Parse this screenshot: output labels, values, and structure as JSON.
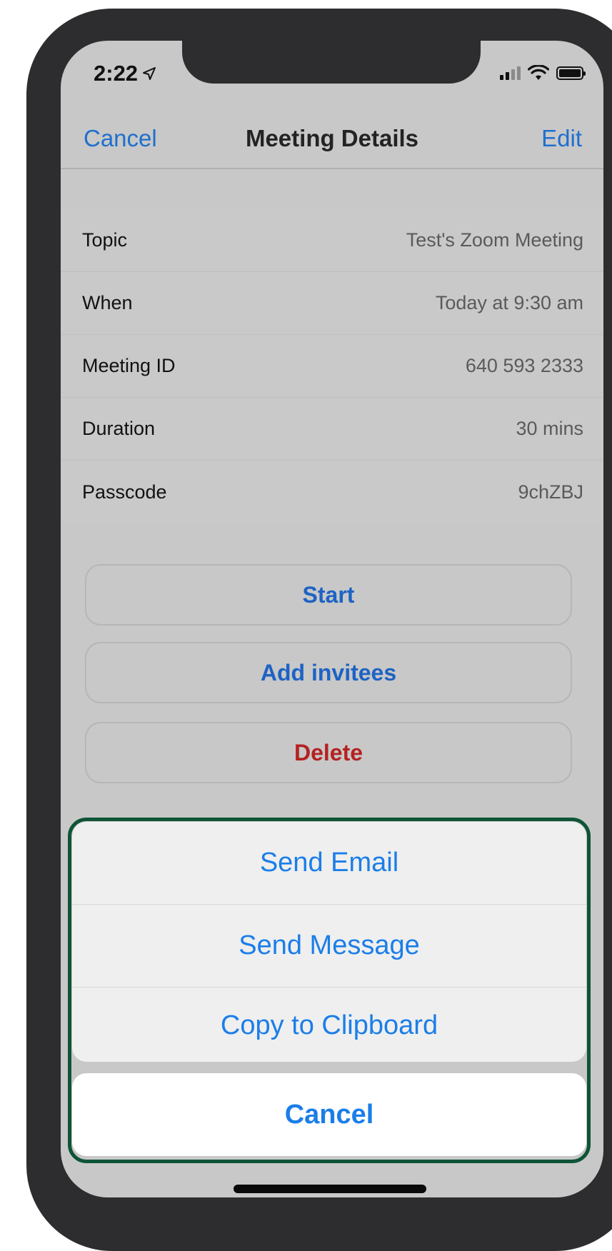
{
  "status": {
    "time": "2:22",
    "location_icon": "location-arrow-icon",
    "signal_icon": "cellular-signal-icon",
    "wifi_icon": "wifi-icon",
    "battery_icon": "battery-icon"
  },
  "nav": {
    "cancel": "Cancel",
    "title": "Meeting Details",
    "edit": "Edit"
  },
  "details": [
    {
      "label": "Topic",
      "value": "Test's Zoom Meeting"
    },
    {
      "label": "When",
      "value": "Today at 9:30 am"
    },
    {
      "label": "Meeting ID",
      "value": "640 593 2333"
    },
    {
      "label": "Duration",
      "value": "30 mins"
    },
    {
      "label": "Passcode",
      "value": "9chZBJ"
    }
  ],
  "actions": {
    "start": "Start",
    "add_invitees": "Add invitees",
    "delete": "Delete"
  },
  "sheet": {
    "items": [
      "Send Email",
      "Send Message",
      "Copy to Clipboard"
    ],
    "cancel": "Cancel"
  },
  "colors": {
    "accent": "#1e6fce",
    "danger": "#b42222",
    "highlight_outline": "#0e5436"
  }
}
